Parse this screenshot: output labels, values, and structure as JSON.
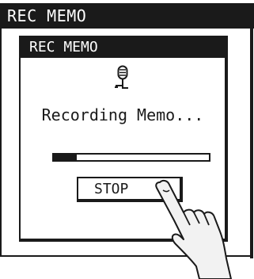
{
  "window": {
    "title": "REC MEMO"
  },
  "dialog": {
    "title": "REC MEMO",
    "icon": "microphone-icon",
    "status_text": "Recording Memo...",
    "progress_fraction": 0.15,
    "stop_label": "STOP"
  },
  "overlay": {
    "icon": "pointing-hand-icon"
  },
  "colors": {
    "ink": "#1a1a1a",
    "paper": "#ffffff",
    "hand_fill": "#f2f2f2"
  }
}
